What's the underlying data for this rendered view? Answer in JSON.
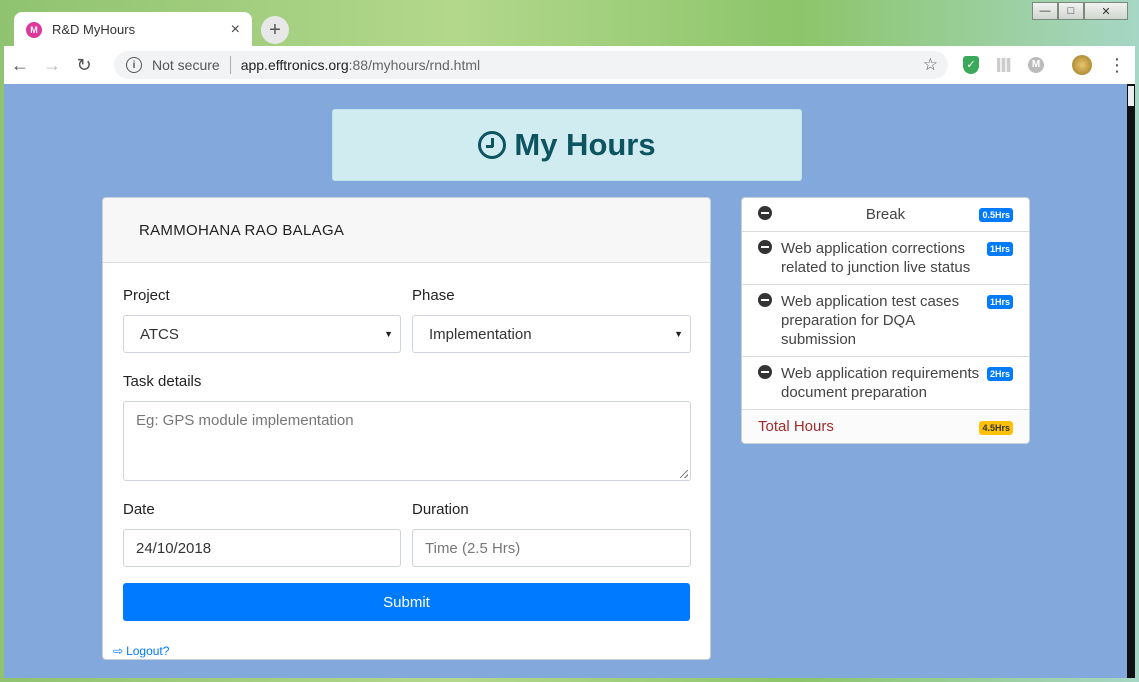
{
  "browser": {
    "tab_title": "R&D MyHours",
    "favicon_glyph": "M",
    "tab_close": "×",
    "new_tab": "+",
    "security_text": "Not secure",
    "url_host": "app.efftronics.org",
    "url_rest": ":88/myhours/rnd.html"
  },
  "window_controls": {
    "minimize": "—",
    "maximize": "□",
    "close": "✕"
  },
  "header": {
    "title": "My Hours"
  },
  "form": {
    "user_name": "RAMMOHANA RAO BALAGA",
    "project_label": "Project",
    "project_value": "ATCS",
    "phase_label": "Phase",
    "phase_value": "Implementation",
    "task_label": "Task details",
    "task_placeholder": "Eg: GPS module implementation",
    "date_label": "Date",
    "date_value": "24/10/2018",
    "duration_label": "Duration",
    "duration_placeholder": "Time (2.5 Hrs)",
    "submit_label": "Submit",
    "logout_label": "Logout?"
  },
  "hours": {
    "items": [
      {
        "text": "Break",
        "hours": "0.5Hrs"
      },
      {
        "text": "Web application corrections related to junction live status",
        "hours": "1Hrs"
      },
      {
        "text": "Web application test cases preparation for DQA submission",
        "hours": "1Hrs"
      },
      {
        "text": "Web application requirements document preparation",
        "hours": "2Hrs"
      }
    ],
    "total_label": "Total Hours",
    "total_value": "4.5Hrs"
  },
  "colors": {
    "page_bg": "#83a8dc",
    "primary": "#007bff",
    "header_bg": "#d1ecf1",
    "total_text": "#a02b2b"
  }
}
